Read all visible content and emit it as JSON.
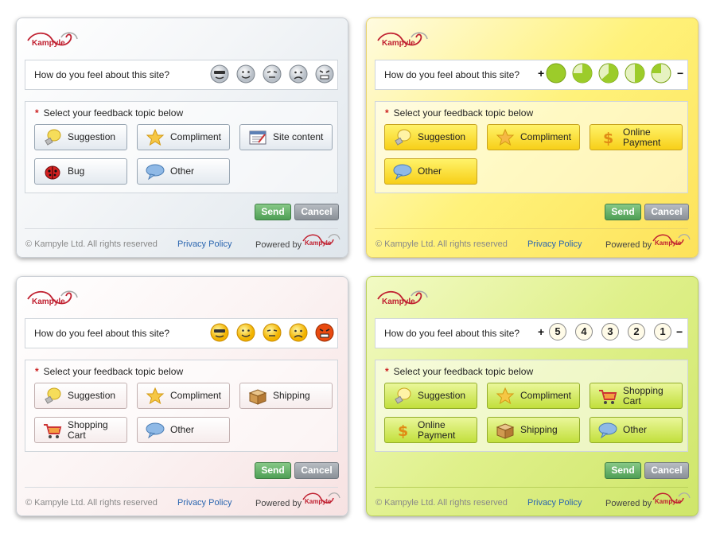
{
  "widgets": [
    {
      "theme": "blue",
      "logo": "Kampyle",
      "question": "How do you feel about this site?",
      "rating_type": "faces-gray",
      "topic_heading": "Select your feedback topic below",
      "topics": [
        {
          "label": "Suggestion",
          "icon": "lightbulb-icon"
        },
        {
          "label": "Compliment",
          "icon": "star-icon"
        },
        {
          "label": "Site content",
          "icon": "document-icon"
        },
        {
          "label": "Bug",
          "icon": "ladybug-icon"
        },
        {
          "label": "Other",
          "icon": "speech-bubble-icon"
        }
      ],
      "send": "Send",
      "cancel": "Cancel",
      "copyright": "© Kampyle Ltd. All rights reserved",
      "privacy": "Privacy Policy",
      "powered_by": "Powered by",
      "mini_logo": "Kampyle"
    },
    {
      "theme": "yellow",
      "logo": "Kampyle",
      "question": "How do you feel about this site?",
      "rating_type": "pies",
      "plus": "+",
      "minus": "−",
      "topic_heading": "Select your feedback topic below",
      "topics": [
        {
          "label": "Suggestion",
          "icon": "lightbulb-icon"
        },
        {
          "label": "Compliment",
          "icon": "star-icon"
        },
        {
          "label": "Online Payment",
          "icon": "dollar-icon"
        },
        {
          "label": "Other",
          "icon": "speech-bubble-icon"
        }
      ],
      "send": "Send",
      "cancel": "Cancel",
      "copyright": "© Kampyle Ltd. All rights reserved",
      "privacy": "Privacy Policy",
      "powered_by": "Powered by",
      "mini_logo": "Kampyle"
    },
    {
      "theme": "pink",
      "logo": "Kampyle",
      "question": "How do you feel about this site?",
      "rating_type": "faces-yellow",
      "topic_heading": "Select your feedback topic below",
      "topics": [
        {
          "label": "Suggestion",
          "icon": "lightbulb-icon"
        },
        {
          "label": "Compliment",
          "icon": "star-icon"
        },
        {
          "label": "Shipping",
          "icon": "box-icon"
        },
        {
          "label": "Shopping Cart",
          "icon": "cart-icon"
        },
        {
          "label": "Other",
          "icon": "speech-bubble-icon"
        }
      ],
      "send": "Send",
      "cancel": "Cancel",
      "copyright": "© Kampyle Ltd. All rights reserved",
      "privacy": "Privacy Policy",
      "powered_by": "Powered by",
      "mini_logo": "Kampyle"
    },
    {
      "theme": "green",
      "logo": "Kampyle",
      "question": "How do you feel about this site?",
      "rating_type": "numbers",
      "plus": "+",
      "minus": "−",
      "numbers": [
        "5",
        "4",
        "3",
        "2",
        "1"
      ],
      "topic_heading": "Select your feedback topic below",
      "topics": [
        {
          "label": "Suggestion",
          "icon": "lightbulb-icon"
        },
        {
          "label": "Compliment",
          "icon": "star-icon"
        },
        {
          "label": "Shopping Cart",
          "icon": "cart-icon"
        },
        {
          "label": "Online Payment",
          "icon": "dollar-icon"
        },
        {
          "label": "Shipping",
          "icon": "box-icon"
        },
        {
          "label": "Other",
          "icon": "speech-bubble-icon"
        }
      ],
      "send": "Send",
      "cancel": "Cancel",
      "copyright": "© Kampyle Ltd. All rights reserved",
      "privacy": "Privacy Policy",
      "powered_by": "Powered by",
      "mini_logo": "Kampyle"
    }
  ],
  "colors": {
    "brand_red": "#c02030",
    "send_green": "#4f9f55",
    "cancel_gray": "#8a9097",
    "link_blue": "#2b66b0"
  }
}
